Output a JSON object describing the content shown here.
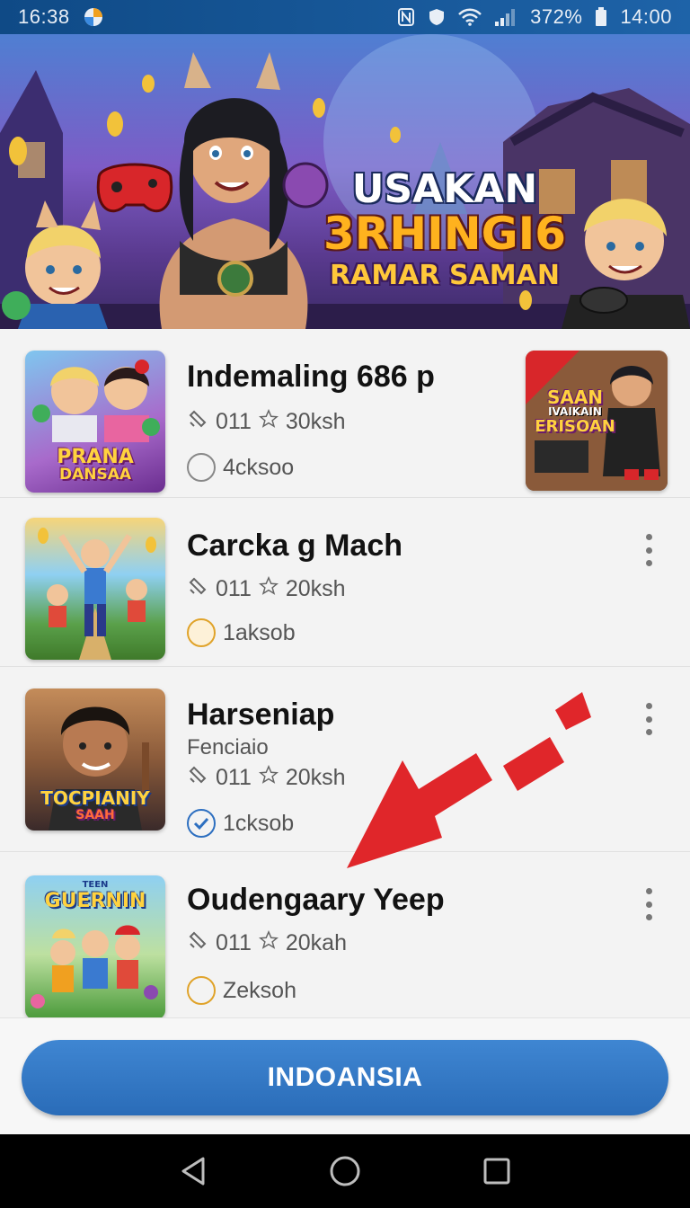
{
  "status_bar": {
    "time": "16:38",
    "battery": "372%",
    "clock": "14:00"
  },
  "banner": {
    "title_line1": "USAKAN",
    "title_line2": "3RHINGI6",
    "title_line3": "RAMAR SAMAN"
  },
  "games": [
    {
      "title": "Indemaling 686 p",
      "meta_code": "011",
      "meta_rating": "30ksh",
      "status": "4cksoo",
      "status_style": "gray",
      "thumb_label_1": "PRANA",
      "thumb_label_2": "DANSAA",
      "side_thumb_label_1": "SAAN",
      "side_thumb_label_2": "IVAIKAIN",
      "side_thumb_label_3": "ERISOAN"
    },
    {
      "title": "Carcka g Mach",
      "meta_code": "011",
      "meta_rating": "20ksh",
      "status": "1aksob",
      "status_style": "orange"
    },
    {
      "title": "Harseniap",
      "subtitle": "Fenciaio",
      "meta_code": "011",
      "meta_rating": "20ksh",
      "status": "1cksob",
      "status_style": "blue-check",
      "thumb_label_1": "TOCPIANIY",
      "thumb_label_2": "SAAH"
    },
    {
      "title": "Oudengaary Yeep",
      "meta_code": "011",
      "meta_rating": "20kah",
      "status": "Zeksoh",
      "status_style": "orange",
      "thumb_label_0": "TEEN",
      "thumb_label_1": "GUERNIN"
    }
  ],
  "primary_button": {
    "label": "INDOANSIA"
  },
  "colors": {
    "status_bar": "#1e63a8",
    "primary_button": "#2f77c4",
    "arrow": "#e0262a",
    "status_orange": "#e0a32a",
    "status_blue": "#2d6fc0"
  },
  "icons": {
    "status_left": [
      "app-logo-icon"
    ],
    "status_right": [
      "nfc-icon",
      "shield-icon",
      "wifi-icon",
      "signal-icon",
      "battery-icon"
    ],
    "meta": [
      "link-icon",
      "star-icon"
    ],
    "row_menu": "more-vertical-icon",
    "nav": [
      "back-icon",
      "home-icon",
      "recents-icon"
    ]
  }
}
